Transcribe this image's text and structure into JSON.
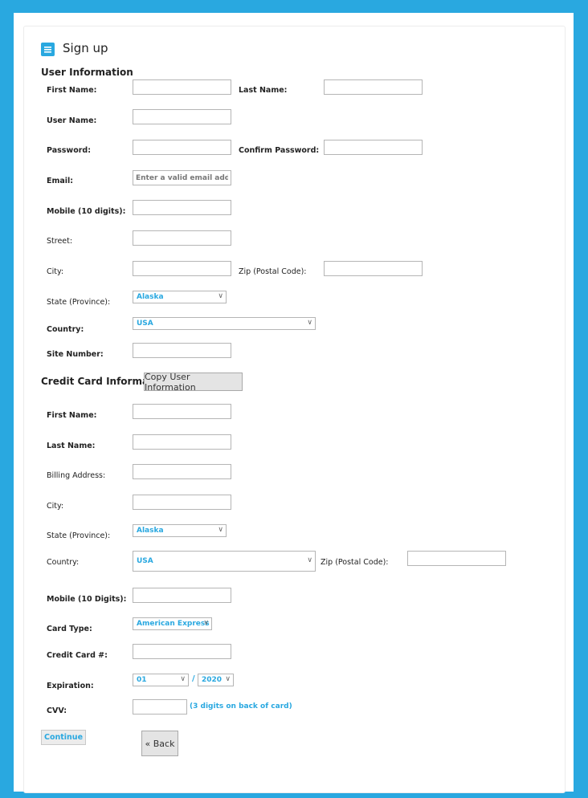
{
  "header": {
    "title": "Sign up"
  },
  "user_section": {
    "title": "User Information",
    "first_name_label": "First Name:",
    "last_name_label": "Last Name:",
    "user_name_label": "User Name:",
    "password_label": "Password:",
    "confirm_password_label": "Confirm Password:",
    "email_label": "Email:",
    "email_placeholder": "Enter a valid email address",
    "mobile_label": "Mobile (10 digits):",
    "street_label": "Street:",
    "city_label": "City:",
    "zip_label": "Zip (Postal Code):",
    "state_label": "State (Province):",
    "state_value": "Alaska",
    "country_label": "Country:",
    "country_value": "USA",
    "site_number_label": "Site Number:"
  },
  "card_section": {
    "title": "Credit Card Information",
    "copy_button": "Copy User Information",
    "first_name_label": "First Name:",
    "last_name_label": "Last Name:",
    "billing_label": "Billing Address:",
    "city_label": "City:",
    "state_label": "State (Province):",
    "state_value": "Alaska",
    "country_label": "Country:",
    "country_value": "USA",
    "zip_label": "Zip (Postal Code):",
    "mobile_label": "Mobile (10 Digits):",
    "card_type_label": "Card Type:",
    "card_type_value": "American Express",
    "card_number_label": "Credit Card #:",
    "expiration_label": "Expiration:",
    "exp_month": "01",
    "exp_separator": "/",
    "exp_year": "2020",
    "cvv_label": "CVV:",
    "cvv_hint": "(3 digits on back of card)"
  },
  "actions": {
    "continue": "Continue",
    "back": "« Back"
  },
  "colors": {
    "accent": "#29a8e0",
    "button_bg": "#e4e4e4"
  },
  "icons": {
    "form": "form-icon",
    "chevron": "chevron-down-icon"
  }
}
